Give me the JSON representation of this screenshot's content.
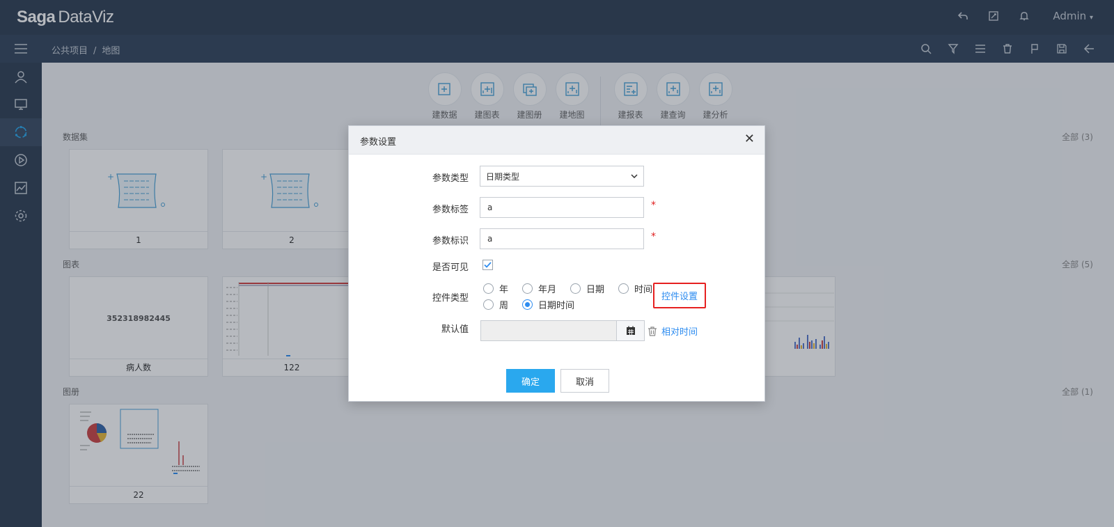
{
  "app": {
    "logo_brand": "Saga",
    "logo_rest": "DataViz",
    "user": "Admin"
  },
  "breadcrumb": {
    "root": "公共项目",
    "separator": "/",
    "current": "地图"
  },
  "create_buttons": [
    {
      "label": "建数据",
      "icon": "data-add-icon"
    },
    {
      "label": "建图表",
      "icon": "chart-add-icon"
    },
    {
      "label": "建图册",
      "icon": "album-add-icon"
    },
    {
      "label": "建地图",
      "icon": "map-add-icon"
    },
    {
      "label": "建报表",
      "icon": "report-add-icon"
    },
    {
      "label": "建查询",
      "icon": "query-add-icon"
    },
    {
      "label": "建分析",
      "icon": "analysis-add-icon"
    }
  ],
  "sections": {
    "datasets": {
      "title": "数据集",
      "count": "全部 (3)",
      "cards": [
        "1",
        "2"
      ]
    },
    "charts": {
      "title": "图表",
      "count": "全部 (5)",
      "cards": [
        "病人数",
        "122"
      ],
      "kpi_value": "352318982445"
    },
    "albums": {
      "title": "图册",
      "count": "全部 (1)",
      "cards": [
        "22"
      ]
    }
  },
  "dialog": {
    "title": "参数设置",
    "param_type": {
      "label": "参数类型",
      "value": "日期类型"
    },
    "param_label": {
      "label": "参数标签",
      "value": "a",
      "required": "*"
    },
    "param_id": {
      "label": "参数标识",
      "value": "a",
      "required": "*"
    },
    "visible": {
      "label": "是否可见",
      "checked": true
    },
    "control_type": {
      "label": "控件类型",
      "options": [
        "年",
        "年月",
        "日期",
        "时间",
        "周",
        "日期时间"
      ],
      "selected": "日期时间",
      "settings_link": "控件设置"
    },
    "default_value": {
      "label": "默认值",
      "value": "",
      "relative_time": "相对时间"
    },
    "ok": "确定",
    "cancel": "取消"
  },
  "colors": {
    "accent": "#2aa8ee",
    "topbar": "#2f3e53",
    "highlight": "#e62020",
    "link": "#2d8cf0"
  }
}
